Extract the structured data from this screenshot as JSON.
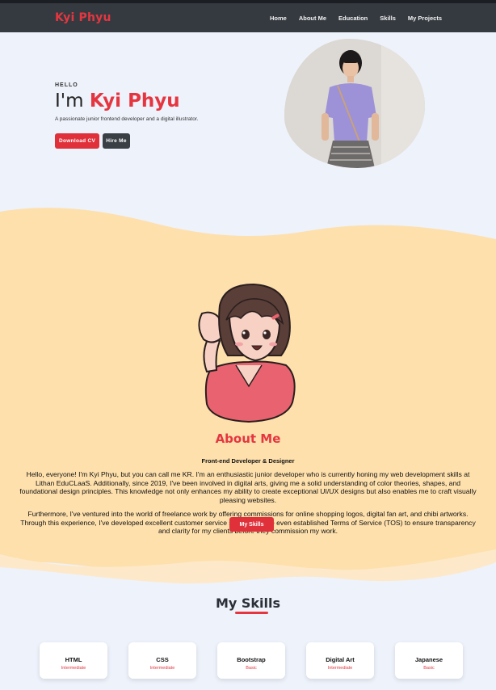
{
  "navbar": {
    "brand": "Kyi Phyu",
    "links": [
      "Home",
      "About Me",
      "Education",
      "Skills",
      "My Projects"
    ]
  },
  "hero": {
    "greeting": "HELLO",
    "title_prefix": "I'm ",
    "title_name": "Kyi Phyu",
    "subtitle": "A passionate junior frontend developer and a digital illustrator.",
    "buttons": [
      "Download CV",
      "Hire Me"
    ]
  },
  "about": {
    "title": "About Me",
    "subtitle": "Front-end Developer & Designer",
    "paragraph1": "Hello, everyone! I'm Kyi Phyu, but you can call me KR. I'm an enthusiastic junior developer who is currently honing my web development skills at Lithan EduCLaaS. Additionally, since 2019, I've been involved in digital arts, giving me a solid understanding of color theories, shapes, and foundational design principles. This knowledge not only enhances my ability to create exceptional UI/UX designs but also enables me to craft visually pleasing websites.",
    "paragraph2": "Furthermore, I've ventured into the world of freelance work by offering commissions for online shopping logos, digital fan art, and chibi artworks. Through this experience, I've developed excellent customer service skills and have even established Terms of Service (TOS) to ensure transparency and clarity for my clients before they commission my work.",
    "button": "My Skills"
  },
  "skills": {
    "title": "My Skills",
    "items": [
      {
        "name": "HTML",
        "level": "Intermediate"
      },
      {
        "name": "CSS",
        "level": "Intermediate"
      },
      {
        "name": "Bootstrap",
        "level": "Basic"
      },
      {
        "name": "Digital Art",
        "level": "Intermediate"
      },
      {
        "name": "Japanese",
        "level": "Basic"
      }
    ]
  },
  "colors": {
    "accent": "#e53640",
    "navbar": "#353a40",
    "page_bg": "#eef2fb",
    "wave": "#fee0ad"
  }
}
